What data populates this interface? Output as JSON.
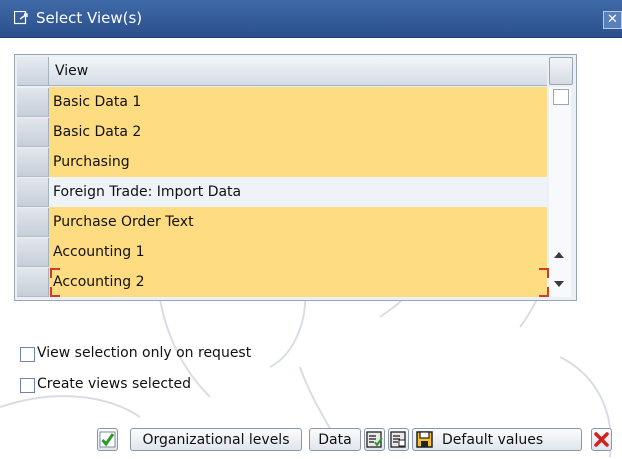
{
  "window": {
    "title": "Select View(s)",
    "close_glyph": "✕"
  },
  "table": {
    "column_header": "View",
    "rows": [
      {
        "label": "Basic Data 1",
        "selected": true
      },
      {
        "label": "Basic Data 2",
        "selected": true
      },
      {
        "label": "Purchasing",
        "selected": true
      },
      {
        "label": "Foreign Trade: Import Data",
        "selected": false
      },
      {
        "label": "Purchase Order Text",
        "selected": true
      },
      {
        "label": "Accounting 1",
        "selected": true
      },
      {
        "label": "Accounting 2",
        "selected": true
      }
    ]
  },
  "options": {
    "view_selection_label": "View selection only on request",
    "view_selection_checked": false,
    "create_views_label": "Create views selected",
    "create_views_checked": false
  },
  "toolbar": {
    "org_levels_label": "Organizational levels",
    "data_label": "Data",
    "default_values_label": "Default values",
    "icons": [
      "check-icon",
      "select-all-icon",
      "deselect-all-icon",
      "save-icon",
      "cancel-icon"
    ]
  },
  "colors": {
    "selected_row": "#fddc82",
    "title_bar": "#2b4f8c",
    "cancel_red": "#d42020",
    "confirm_green": "#2e9b2e"
  }
}
